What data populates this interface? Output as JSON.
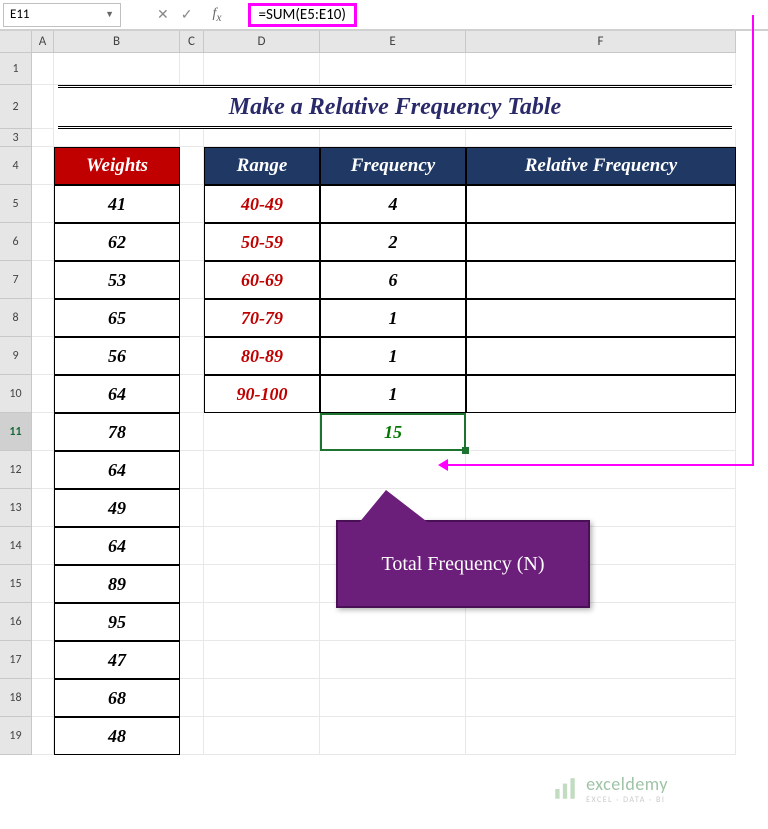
{
  "nameBox": {
    "ref": "E11"
  },
  "formula": "=SUM(E5:E10)",
  "colHeaders": [
    "",
    "A",
    "B",
    "C",
    "D",
    "E",
    "F"
  ],
  "rowHeaders": [
    "1",
    "2",
    "3",
    "4",
    "5",
    "6",
    "7",
    "8",
    "9",
    "10",
    "11",
    "12",
    "13",
    "14",
    "15",
    "16",
    "17",
    "18",
    "19"
  ],
  "title": "Make a Relative Frequency Table",
  "weightsHeader": "Weights",
  "rangeHeader": "Range",
  "freqHeader": "Frequency",
  "relFreqHeader": "Relative Frequency",
  "weights": [
    "41",
    "62",
    "53",
    "65",
    "56",
    "64",
    "78",
    "64",
    "49",
    "64",
    "89",
    "95",
    "47",
    "68",
    "48"
  ],
  "ranges": [
    "40-49",
    "50-59",
    "60-69",
    "70-79",
    "80-89",
    "90-100"
  ],
  "freqs": [
    "4",
    "2",
    "6",
    "1",
    "1",
    "1"
  ],
  "totalFreq": "15",
  "callout": "Total Frequency (N)",
  "watermark": {
    "brand": "exceldemy",
    "tag": "EXCEL · DATA · BI"
  },
  "chart_data": {
    "type": "table",
    "title": "Make a Relative Frequency Table",
    "columns": [
      "Range",
      "Frequency",
      "Relative Frequency"
    ],
    "rows": [
      [
        "40-49",
        4,
        null
      ],
      [
        "50-59",
        2,
        null
      ],
      [
        "60-69",
        6,
        null
      ],
      [
        "70-79",
        1,
        null
      ],
      [
        "80-89",
        1,
        null
      ],
      [
        "90-100",
        1,
        null
      ]
    ],
    "total_frequency": 15,
    "weights_raw": [
      41,
      62,
      53,
      65,
      56,
      64,
      78,
      64,
      49,
      64,
      89,
      95,
      47,
      68,
      48
    ]
  }
}
